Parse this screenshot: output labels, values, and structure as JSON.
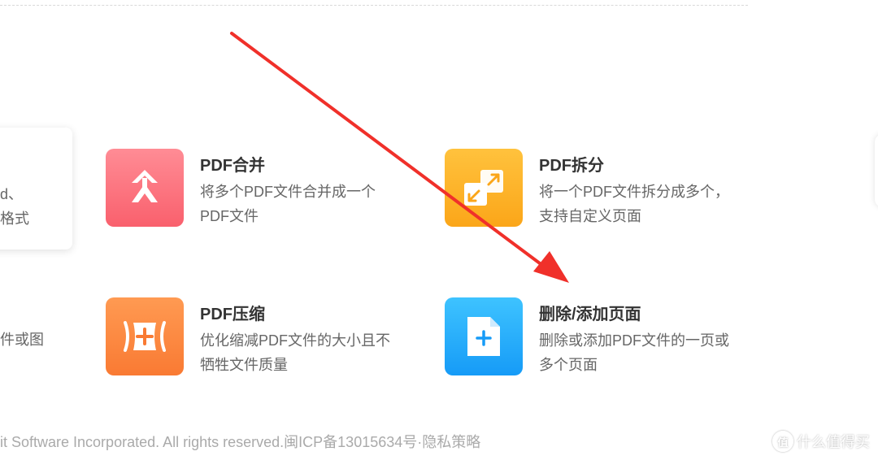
{
  "partial_card": {
    "line1": "d、",
    "line2": "格式"
  },
  "partial_row2_text": "件或图",
  "tools": {
    "merge": {
      "title": "PDF合并",
      "desc": "将多个PDF文件合并成一个PDF文件"
    },
    "split": {
      "title": "PDF拆分",
      "desc": "将一个PDF文件拆分成多个， 支持自定义页面"
    },
    "compress": {
      "title": "PDF压缩",
      "desc": "优化缩减PDF文件的大小且不牺牲文件质量"
    },
    "pages": {
      "title": "删除/添加页面",
      "desc": "删除或添加PDF文件的一页或多个页面"
    }
  },
  "footer": {
    "text": "it Software Incorporated. All rights reserved.闽ICP备13015634号·隐私策略"
  },
  "watermark": {
    "logo": "值",
    "text": "什么值得买"
  },
  "colors": {
    "annotation_arrow": "#f0302a",
    "merge_icon": "#f9606d",
    "split_icon": "#fba619",
    "compress_icon": "#f97a33",
    "pages_icon": "#169bf7"
  }
}
